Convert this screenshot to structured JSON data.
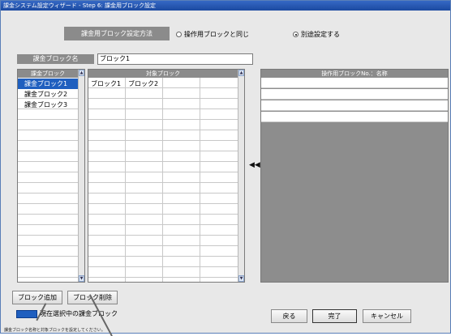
{
  "window": {
    "title": "課金システム設定ウィザード - Step 6: 課金用ブロック設定"
  },
  "method": {
    "label": "課金用ブロック設定方法",
    "options": [
      {
        "label": "操作用ブロックと同じ",
        "selected": false
      },
      {
        "label": "別途設定する",
        "selected": true
      }
    ]
  },
  "block_name": {
    "label": "課金ブロック名",
    "value": "ブロック1"
  },
  "billing_list": {
    "header": "課金ブロック",
    "items": [
      "課金ブロック1",
      "課金ブロック2",
      "課金ブロック3"
    ],
    "selected_index": 0
  },
  "target_blocks": {
    "header": "対象ブロック",
    "cells": [
      "ブロック1",
      "ブロック2"
    ]
  },
  "transfer_button": {
    "label": "◀◀"
  },
  "op_blocks": {
    "header": "操作用ブロックNo.：名称",
    "rows": [
      "",
      "",
      "",
      ""
    ]
  },
  "buttons": {
    "add": "ブロック追加",
    "delete": "ブロック削除",
    "back": "戻る",
    "finish": "完了",
    "cancel": "キャンセル"
  },
  "legend": {
    "text": "現在選択中の課金ブロック"
  },
  "status": {
    "text": "課金ブロック名称と対象ブロックを設定してください。"
  },
  "colors": {
    "selection": "#1f5fbf",
    "header": "#8b8b8b",
    "titlebar": "#2a5bb8"
  }
}
